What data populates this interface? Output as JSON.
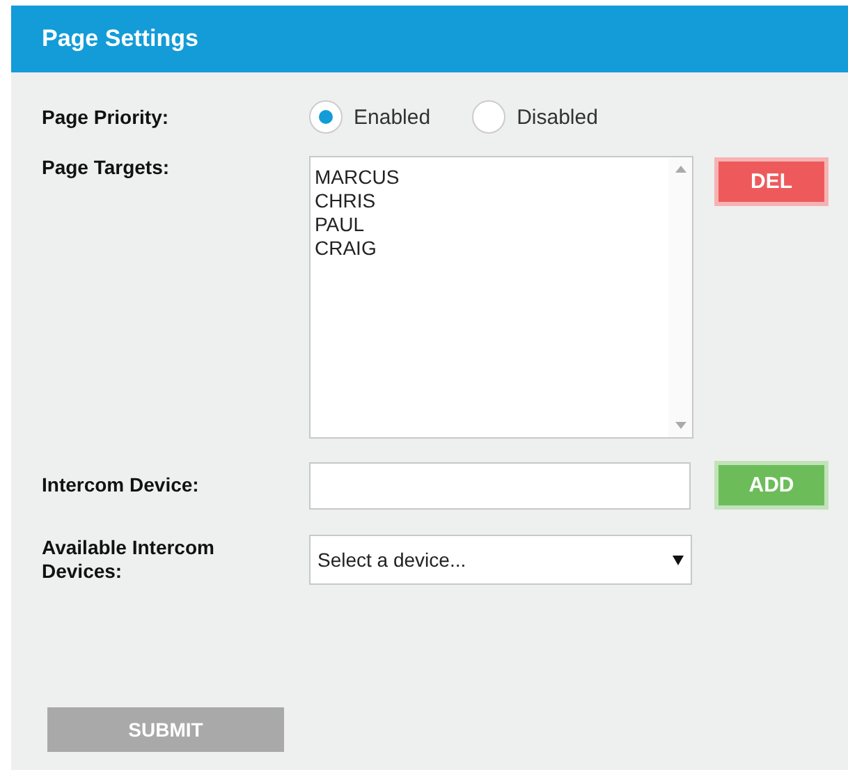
{
  "panel": {
    "title": "Page Settings"
  },
  "page_priority": {
    "label": "Page Priority:",
    "options": [
      {
        "label": "Enabled",
        "selected": true
      },
      {
        "label": "Disabled",
        "selected": false
      }
    ]
  },
  "page_targets": {
    "label": "Page Targets:",
    "items": [
      "MARCUS",
      "CHRIS",
      "PAUL",
      "CRAIG"
    ],
    "button": {
      "label": "DEL",
      "kind": "danger"
    }
  },
  "intercom_device": {
    "label": "Intercom Device:",
    "button": {
      "label": "ADD",
      "kind": "success"
    }
  },
  "available_devices": {
    "label": "Available Intercom Devices:",
    "value": "Select a device..."
  },
  "submit": {
    "label": "SUBMIT",
    "disabled": true
  }
}
